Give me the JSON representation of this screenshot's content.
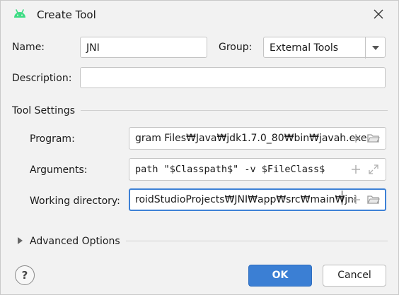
{
  "window": {
    "title": "Create Tool",
    "app_icon": "android-icon",
    "close_icon": "close-icon"
  },
  "form": {
    "name_label": "Name:",
    "name_value": "JNI",
    "group_label": "Group:",
    "group_value": "External Tools",
    "description_label": "Description:",
    "description_value": ""
  },
  "tool_settings": {
    "section_label": "Tool Settings",
    "program_label": "Program:",
    "program_value": "gram Files₩Java₩jdk1.7.0_80₩bin₩javah.exe",
    "arguments_label": "Arguments:",
    "arguments_value": "path \"$Classpath$\" -v $FileClass$",
    "working_dir_label": "Working directory:",
    "working_dir_value": "roidStudioProjects₩JNI₩app₩src₩main₩jni"
  },
  "advanced": {
    "label": "Advanced Options",
    "expanded": false
  },
  "buttons": {
    "ok": "OK",
    "cancel": "Cancel",
    "help": "?"
  },
  "colors": {
    "accent": "#3b7fd4",
    "android_green": "#3ddc84",
    "focus_border": "#3d81d6"
  }
}
